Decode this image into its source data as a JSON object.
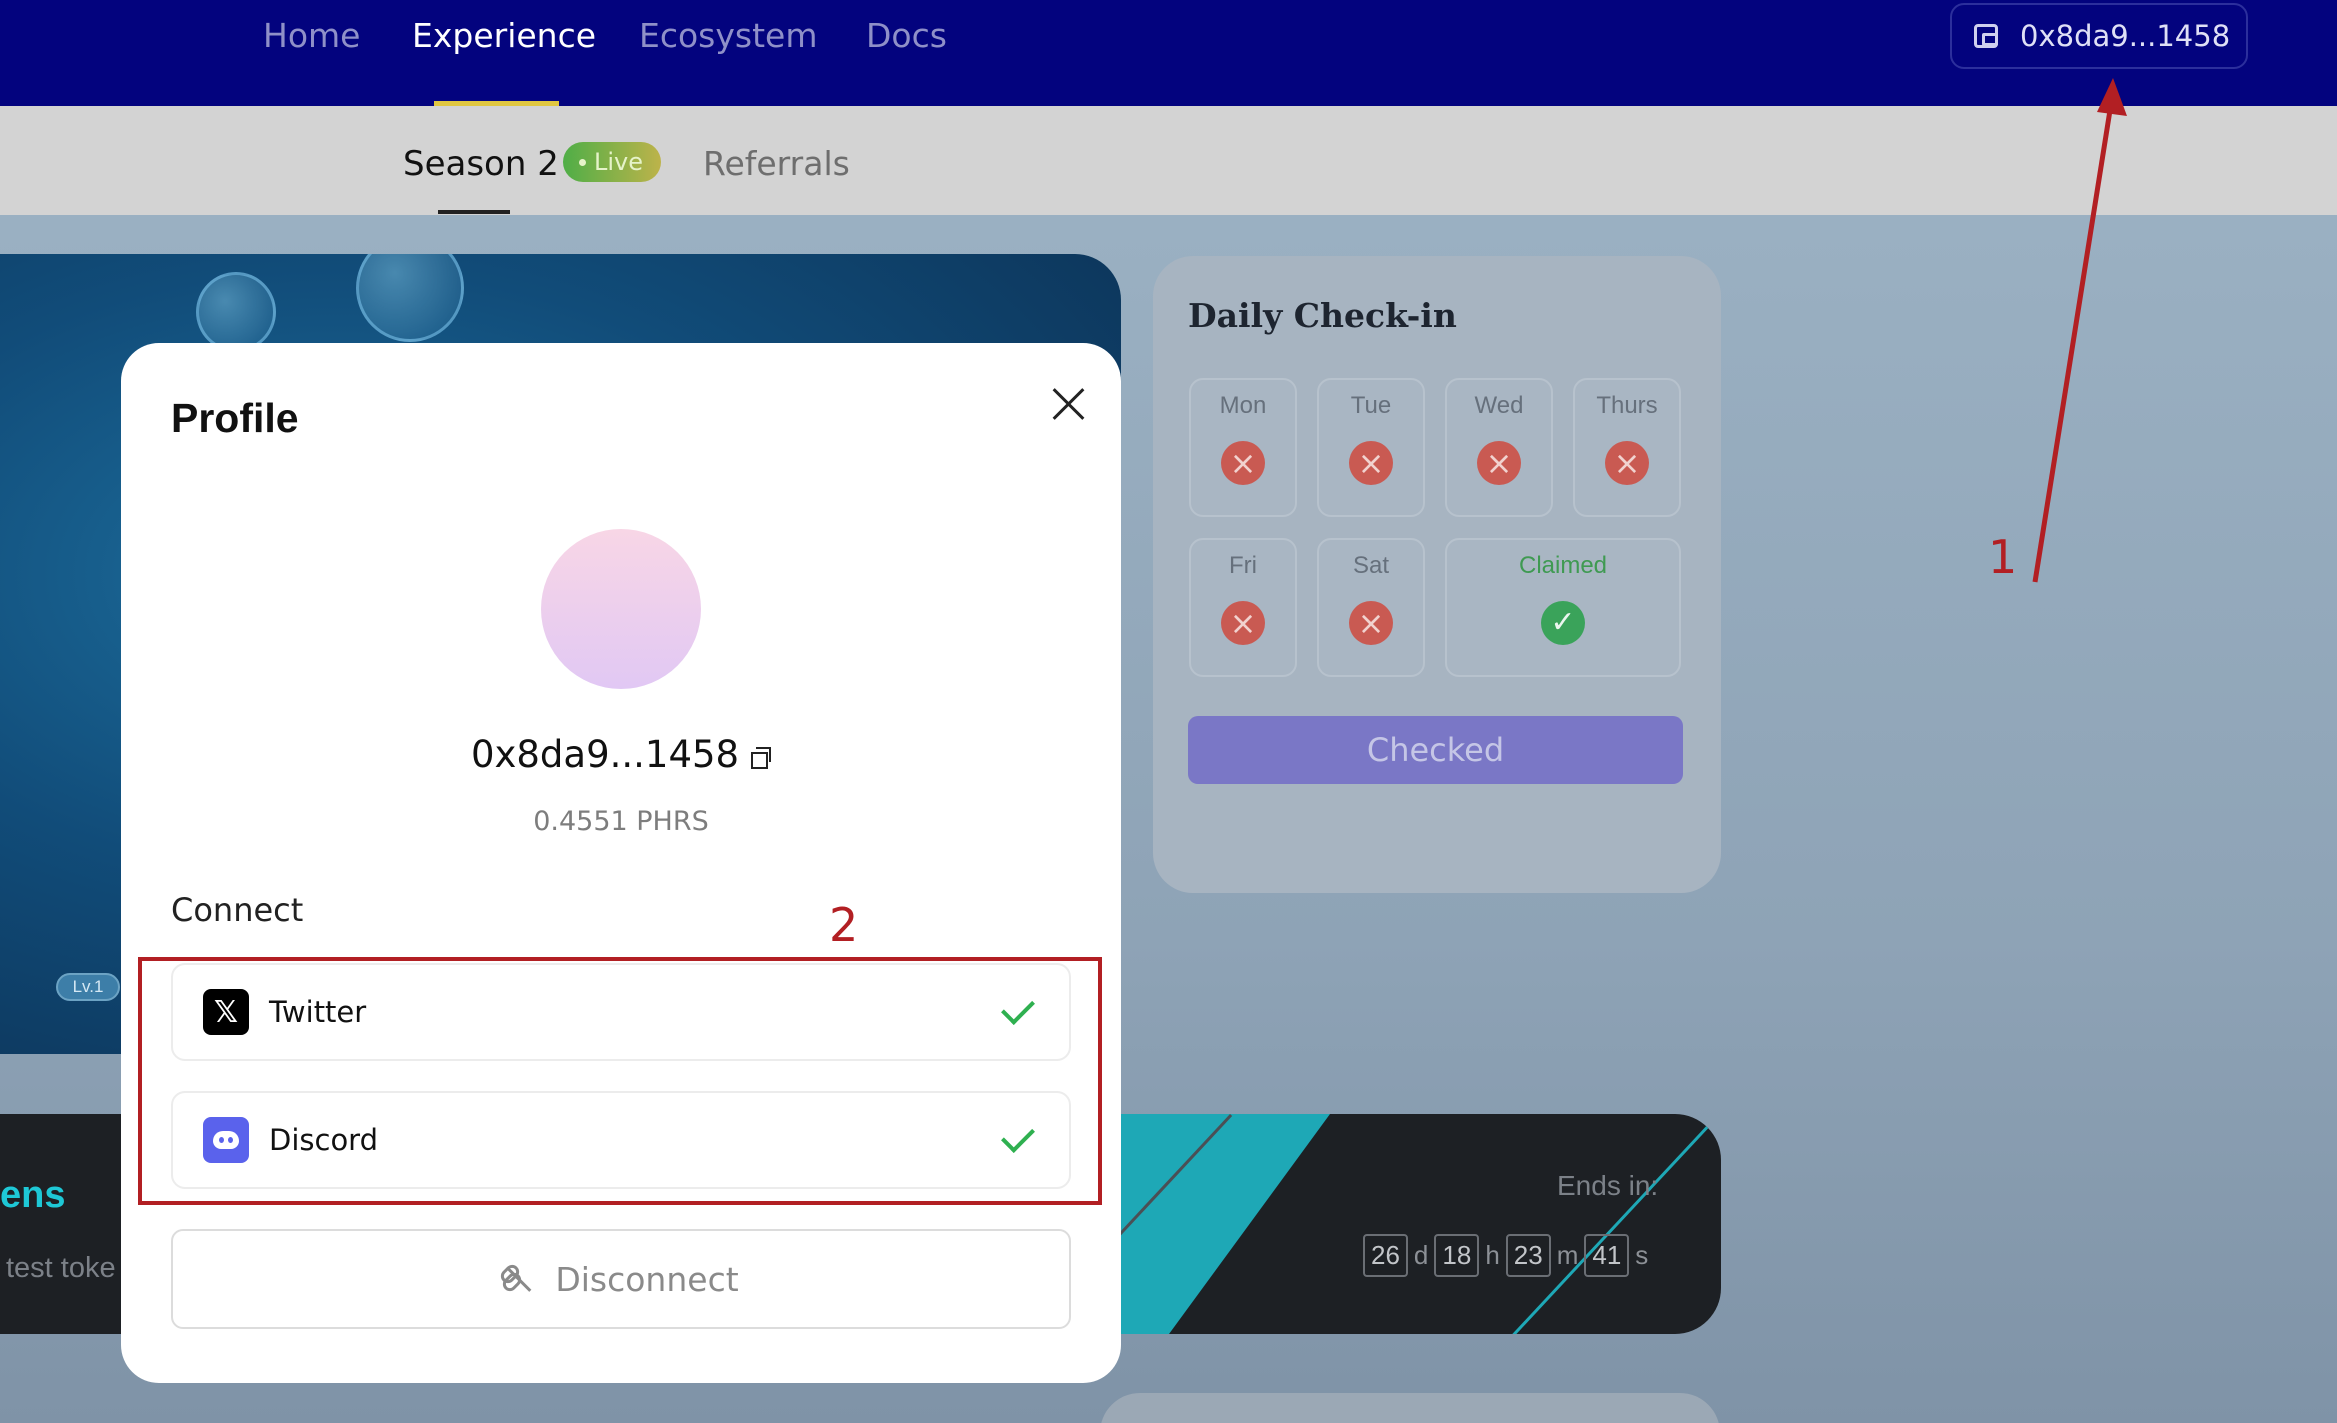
{
  "nav": {
    "items": [
      {
        "label": "Home",
        "active": false
      },
      {
        "label": "Experience",
        "active": true
      },
      {
        "label": "Ecosystem",
        "active": false
      },
      {
        "label": "Docs",
        "active": false
      }
    ],
    "wallet_label": "0x8da9...1458",
    "wallet_icon": "wallet-icon"
  },
  "subnav": {
    "season_label": "Season 2",
    "live_badge": "Live",
    "referrals_label": "Referrals"
  },
  "hero": {
    "level_badge": "Lv.1"
  },
  "banner": {
    "title_fragment": "ens",
    "subtitle_fragment": "test toke",
    "ends_label": "Ends in:",
    "countdown": {
      "days": "26",
      "days_unit": "d",
      "hours": "18",
      "hours_unit": "h",
      "minutes": "23",
      "minutes_unit": "m",
      "seconds": "41",
      "seconds_unit": "s"
    }
  },
  "checkin": {
    "title": "Daily Check-in",
    "days": [
      {
        "label": "Mon",
        "status": "missed"
      },
      {
        "label": "Tue",
        "status": "missed"
      },
      {
        "label": "Wed",
        "status": "missed"
      },
      {
        "label": "Thurs",
        "status": "missed"
      },
      {
        "label": "Fri",
        "status": "missed"
      },
      {
        "label": "Sat",
        "status": "missed"
      },
      {
        "label": "Claimed",
        "status": "claimed"
      }
    ],
    "button_label": "Checked",
    "status_colors": {
      "missed": "#c95a52",
      "claimed": "#3aa35a"
    }
  },
  "modal": {
    "title": "Profile",
    "address": "0x8da9...1458",
    "balance": "0.4551 PHRS",
    "connect_label": "Connect",
    "connections": [
      {
        "name": "Twitter",
        "icon": "x-logo-icon",
        "connected": true
      },
      {
        "name": "Discord",
        "icon": "discord-logo-icon",
        "connected": true
      }
    ],
    "disconnect_label": "Disconnect"
  },
  "annotations": {
    "marker_1": "1",
    "marker_2": "2",
    "color": "#b21f23"
  },
  "colors": {
    "nav_bg": "#03037e",
    "accent_underline": "#e0c640",
    "check_green": "#2fb050"
  }
}
